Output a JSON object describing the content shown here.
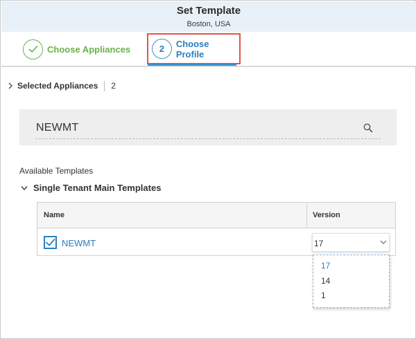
{
  "header": {
    "title": "Set Template",
    "subtitle": "Boston, USA"
  },
  "steps": [
    {
      "number": "✓",
      "label": "Choose Appliances",
      "state": "done",
      "color": "#6ab04c"
    },
    {
      "number": "2",
      "label": "Choose Profile",
      "state": "active",
      "color": "#2b7fbf"
    }
  ],
  "selected_appliances": {
    "label": "Selected Appliances",
    "count": "2"
  },
  "search": {
    "value": "NEWMT",
    "icon": "search-icon"
  },
  "templates": {
    "section_label": "Available Templates",
    "group_label": "Single Tenant Main Templates",
    "columns": [
      "Name",
      "Version"
    ],
    "rows": [
      {
        "name": "NEWMT",
        "checked": true,
        "version": "17"
      }
    ]
  },
  "version_dropdown": {
    "selected": "17",
    "options": [
      "17",
      "14",
      "1"
    ]
  },
  "colors": {
    "accent": "#2b7fbf",
    "done": "#6ab04c",
    "highlight_border": "#e0544a",
    "header_bg": "#e8f1f8"
  }
}
